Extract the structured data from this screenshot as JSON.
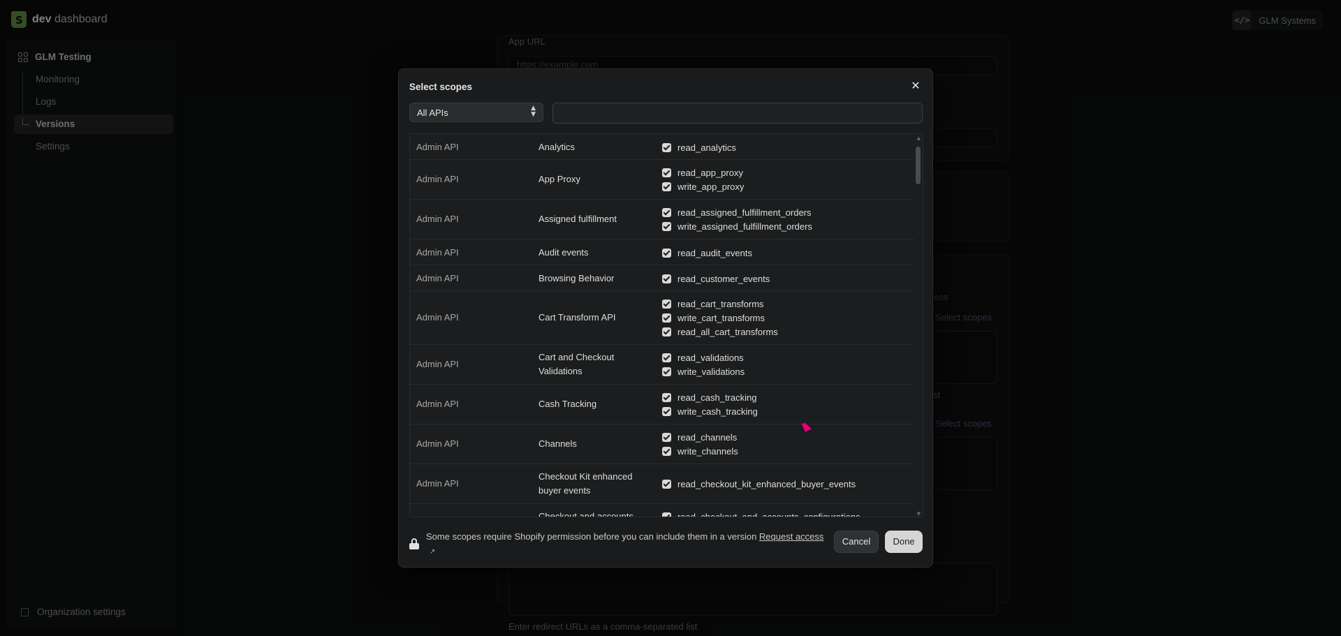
{
  "topbar": {
    "brand_bold": "dev",
    "brand_rest": " dashboard",
    "org_name": "GLM Systems",
    "org_icon": "code-icon"
  },
  "sidebar": {
    "app_name": "GLM Testing",
    "items": [
      {
        "label": "Monitoring"
      },
      {
        "label": "Logs"
      },
      {
        "label": "Versions",
        "active": true
      },
      {
        "label": "Settings"
      }
    ],
    "org_settings": "Organization settings"
  },
  "background_form": {
    "app_url_label": "App URL",
    "app_url_placeholder": "https://example.com",
    "partial_access_link": "ess",
    "select_scopes_1": "Select scopes",
    "select_scopes_2": "Select scopes",
    "partial_list_hint": "st",
    "redirect_hint": "Enter redirect URLs as a comma-separated list"
  },
  "modal": {
    "title": "Select scopes",
    "close_icon": "close-icon",
    "api_filter": "All APIs",
    "search_value": "",
    "rows": [
      {
        "api": "Admin API",
        "area": "Analytics",
        "scopes": [
          "read_analytics"
        ]
      },
      {
        "api": "Admin API",
        "area": "App Proxy",
        "scopes": [
          "read_app_proxy",
          "write_app_proxy"
        ]
      },
      {
        "api": "Admin API",
        "area": "Assigned fulfillment",
        "scopes": [
          "read_assigned_fulfillment_orders",
          "write_assigned_fulfillment_orders"
        ]
      },
      {
        "api": "Admin API",
        "area": "Audit events",
        "scopes": [
          "read_audit_events"
        ]
      },
      {
        "api": "Admin API",
        "area": "Browsing Behavior",
        "scopes": [
          "read_customer_events"
        ]
      },
      {
        "api": "Admin API",
        "area": "Cart Transform API",
        "scopes": [
          "read_cart_transforms",
          "write_cart_transforms",
          "read_all_cart_transforms"
        ]
      },
      {
        "api": "Admin API",
        "area": "Cart and Checkout Validations",
        "scopes": [
          "read_validations",
          "write_validations"
        ]
      },
      {
        "api": "Admin API",
        "area": "Cash Tracking",
        "scopes": [
          "read_cash_tracking",
          "write_cash_tracking"
        ]
      },
      {
        "api": "Admin API",
        "area": "Channels",
        "scopes": [
          "read_channels",
          "write_channels"
        ]
      },
      {
        "api": "Admin API",
        "area": "Checkout Kit enhanced buyer events",
        "scopes": [
          "read_checkout_kit_enhanced_buyer_events"
        ]
      },
      {
        "api": "",
        "area": "Checkout and accounts",
        "scopes": [
          "read_checkout_and_accounts_configurations"
        ]
      }
    ],
    "footer_text": "Some scopes require Shopify permission before you can include them in a version ",
    "footer_link": "Request access",
    "cancel_label": "Cancel",
    "done_label": "Done"
  },
  "colors": {
    "brand_green": "#5e8e3e",
    "accent_cursor": "#e6007e",
    "done_bg": "#d6d6d6"
  }
}
